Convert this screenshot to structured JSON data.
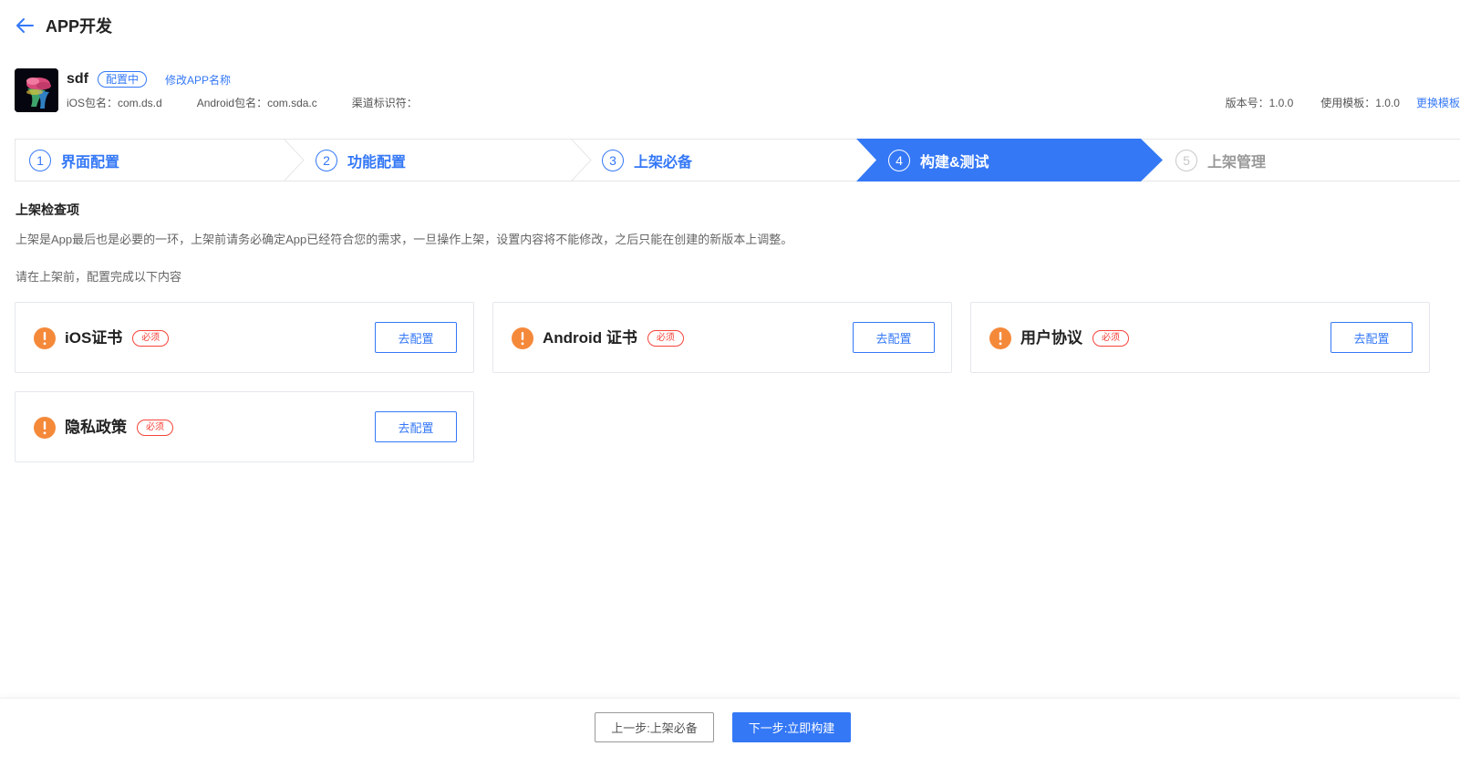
{
  "header": {
    "title": "APP开发"
  },
  "app": {
    "name": "sdf",
    "status": "配置中",
    "rename_link": "修改APP名称",
    "ios_package": "iOS包名：com.ds.d",
    "android_package": "Android包名：com.sda.c",
    "channel_id": "渠道标识符：",
    "version": "版本号：1.0.0",
    "template": "使用模板：1.0.0",
    "change_template": "更换模板"
  },
  "steps": [
    {
      "number": "1",
      "label": "界面配置",
      "state": "done"
    },
    {
      "number": "2",
      "label": "功能配置",
      "state": "done"
    },
    {
      "number": "3",
      "label": "上架必备",
      "state": "done"
    },
    {
      "number": "4",
      "label": "构建&测试",
      "state": "active"
    },
    {
      "number": "5",
      "label": "上架管理",
      "state": "pending"
    }
  ],
  "section": {
    "title": "上架检查项",
    "description": "上架是App最后也是必要的一环，上架前请务必确定App已经符合您的需求，一旦操作上架，设置内容将不能修改，之后只能在创建的新版本上调整。",
    "hint": "请在上架前，配置完成以下内容"
  },
  "checklist": [
    {
      "name": "iOS证书",
      "tag": "必须",
      "button": "去配置"
    },
    {
      "name": "Android 证书",
      "tag": "必须",
      "button": "去配置"
    },
    {
      "name": "用户协议",
      "tag": "必须",
      "button": "去配置"
    },
    {
      "name": "隐私政策",
      "tag": "必须",
      "button": "去配置"
    }
  ],
  "footer": {
    "prev_label": "上一步:上架必备",
    "next_label": "下一步:立即构建"
  },
  "colors": {
    "primary": "#3478f6",
    "warning": "#f5893a",
    "required": "#f5443a"
  }
}
